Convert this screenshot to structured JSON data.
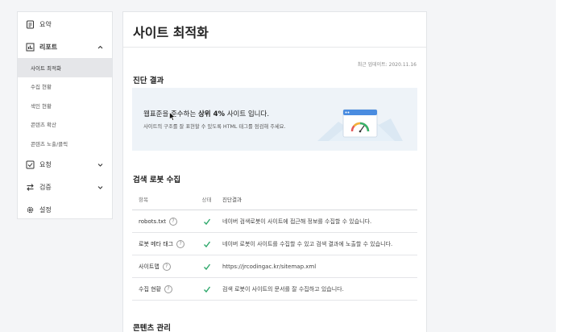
{
  "sidebar": {
    "summary": {
      "label": "요약",
      "icon": "document-icon"
    },
    "report": {
      "label": "리포트",
      "icon": "bar-chart-icon"
    },
    "report_items": [
      {
        "label": "사이트 최적화",
        "active": true
      },
      {
        "label": "수집 현황",
        "active": false
      },
      {
        "label": "색인 현황",
        "active": false
      },
      {
        "label": "콘텐츠 확산",
        "active": false
      },
      {
        "label": "콘텐츠 노출/클릭",
        "active": false
      }
    ],
    "request": {
      "label": "요청",
      "icon": "checkbox-icon"
    },
    "verify": {
      "label": "검증",
      "icon": "swap-arrows-icon"
    },
    "settings": {
      "label": "설정",
      "icon": "gear-icon"
    }
  },
  "main": {
    "title": "사이트 최적화",
    "updated": "최근 업데이트: 2020.11.16",
    "diagnosis": {
      "title": "진단 결과",
      "main_prefix": "웹표준을 준수하는 ",
      "main_bold": "상위 4%",
      "main_suffix": " 사이트 입니다.",
      "sub": "사이트의 구조를 잘 표현할 수 있도록 HTML 태그를 점검해 주세요."
    },
    "crawl": {
      "title": "검색 로봇 수집",
      "headers": [
        "항목",
        "상태",
        "진단결과"
      ],
      "rows": [
        {
          "item": "robots.txt",
          "result": "네이버 검색로봇이 사이트에 접근해 정보를 수집할 수 있습니다."
        },
        {
          "item": "로봇 메타 태그",
          "result": "네이버 로봇이 사이트를 수집할 수 있고 검색 결과에 노출할 수 있습니다."
        },
        {
          "item": "사이트맵",
          "result": "https://jrcodingac.kr/sitemap.xml"
        },
        {
          "item": "수집 현황",
          "result": "검색 로봇이 사이트의 문서를 잘 수집하고 있습니다."
        }
      ]
    },
    "contents": {
      "title": "콘텐츠 관리"
    }
  },
  "colors": {
    "check": "#2ea86b",
    "banner_bg": "#eef3f8"
  }
}
